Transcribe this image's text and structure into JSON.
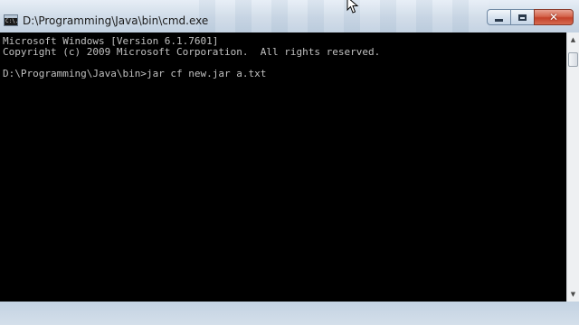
{
  "window": {
    "title": "D:\\Programming\\Java\\bin\\cmd.exe",
    "icon": "cmd-icon",
    "icon_text": "C:\\."
  },
  "controls": {
    "minimize_icon": "minimize-icon",
    "maximize_icon": "maximize-icon",
    "close_icon": "close-icon",
    "close_glyph": "✕"
  },
  "console": {
    "text": "Microsoft Windows [Version 6.1.7601]\nCopyright (c) 2009 Microsoft Corporation.  All rights reserved.\n\nD:\\Programming\\Java\\bin>jar cf new.jar a.txt",
    "background": "#000000",
    "foreground": "#c0c0c0"
  },
  "scrollbar": {
    "up_arrow": "▲",
    "down_arrow": "▼"
  },
  "colors": {
    "close_button": "#c4422a",
    "frame": "#c3d2e2"
  }
}
